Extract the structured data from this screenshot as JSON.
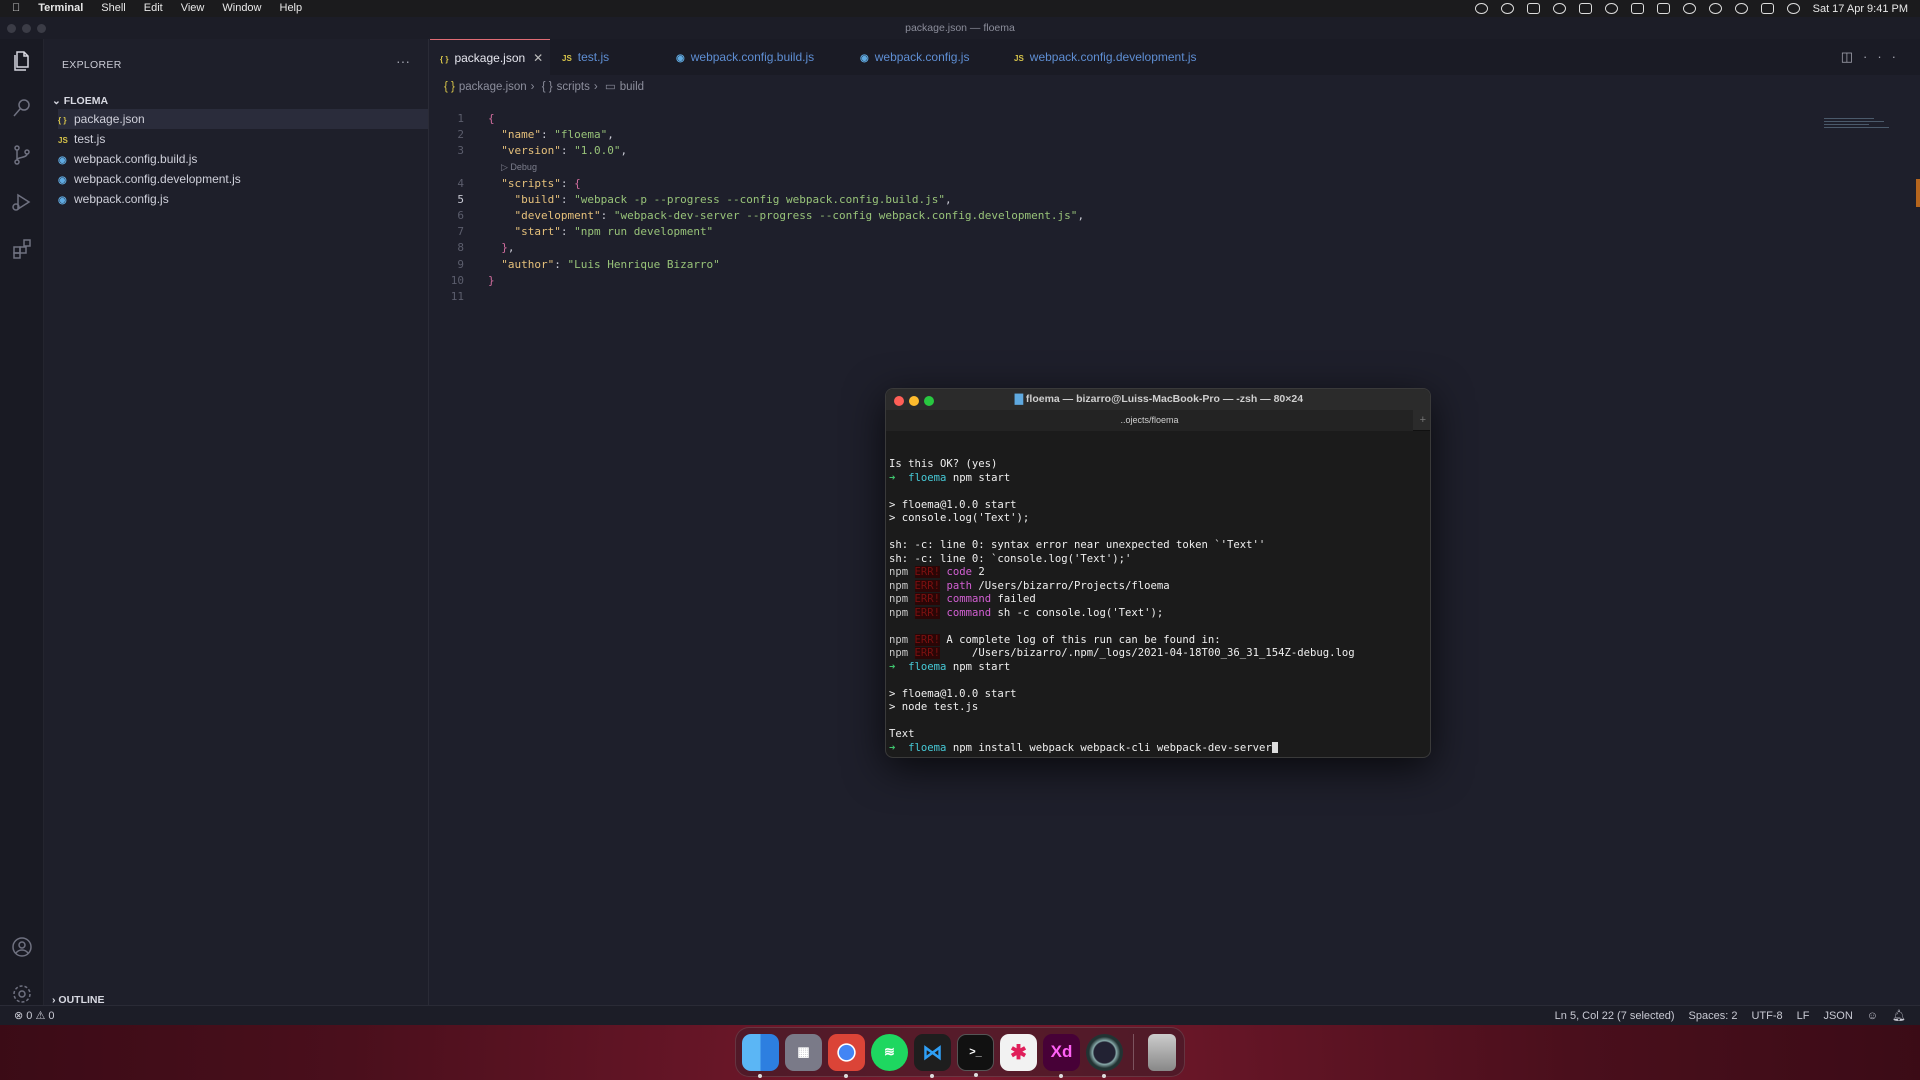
{
  "menubar": {
    "app": "Terminal",
    "items": [
      "Shell",
      "Edit",
      "View",
      "Window",
      "Help"
    ],
    "datetime": "Sat 17 Apr  9:41 PM"
  },
  "vscode": {
    "window_title": "package.json — floema",
    "explorer": {
      "title": "EXPLORER",
      "folder": "FLOEMA",
      "files": [
        "package.json",
        "test.js",
        "webpack.config.build.js",
        "webpack.config.development.js",
        "webpack.config.js"
      ],
      "outline": "OUTLINE"
    },
    "tabs": [
      "package.json",
      "test.js",
      "webpack.config.build.js",
      "webpack.config.js",
      "webpack.config.development.js"
    ],
    "breadcrumb": [
      "package.json",
      "scripts",
      "build"
    ],
    "codelens": "▷ Debug",
    "code_lines": [
      "{",
      "  \"name\": \"floema\",",
      "  \"version\": \"1.0.0\",",
      "  \"scripts\": {",
      "    \"build\": \"webpack -p --progress --config webpack.config.build.js\",",
      "    \"development\": \"webpack-dev-server --progress --config webpack.config.development.js\",",
      "    \"start\": \"npm run development\"",
      "  },",
      "  \"author\": \"Luis Henrique Bizarro\"",
      "}",
      ""
    ],
    "status": {
      "problems": "⊗ 0 ⚠ 0",
      "position": "Ln 5, Col 22 (7 selected)",
      "spaces": "Spaces: 2",
      "encoding": "UTF-8",
      "eol": "LF",
      "language": "JSON"
    }
  },
  "terminal": {
    "title": "floema — bizarro@Luiss-MacBook-Pro — -zsh — 80×24",
    "tab": "..ojects/floema",
    "lines": [
      "Is this OK? (yes)",
      "➜  floema npm start",
      "",
      "> floema@1.0.0 start",
      "> console.log('Text');",
      "",
      "sh: -c: line 0: syntax error near unexpected token `'Text''",
      "sh: -c: line 0: `console.log('Text');'",
      "npm ERR! code 2",
      "npm ERR! path /Users/bizarro/Projects/floema",
      "npm ERR! command failed",
      "npm ERR! command sh -c console.log('Text');",
      "",
      "npm ERR! A complete log of this run can be found in:",
      "npm ERR!     /Users/bizarro/.npm/_logs/2021-04-18T00_36_31_154Z-debug.log",
      "➜  floema npm start",
      "",
      "> floema@1.0.0 start",
      "> node test.js",
      "",
      "Text",
      "➜  floema npm install webpack webpack-cli webpack-dev-server"
    ]
  },
  "dock": {
    "apps": [
      "Finder",
      "Launchpad",
      "Chrome",
      "Spotify",
      "VS Code",
      "Terminal",
      "Slack",
      "Adobe XD",
      "QuickTime",
      "Trash"
    ],
    "labels": {
      "xd": "Xd",
      "terminal": ">_"
    }
  },
  "colors": {
    "accent_tab": "#e06c75",
    "desktop": "#4a0f1c"
  }
}
